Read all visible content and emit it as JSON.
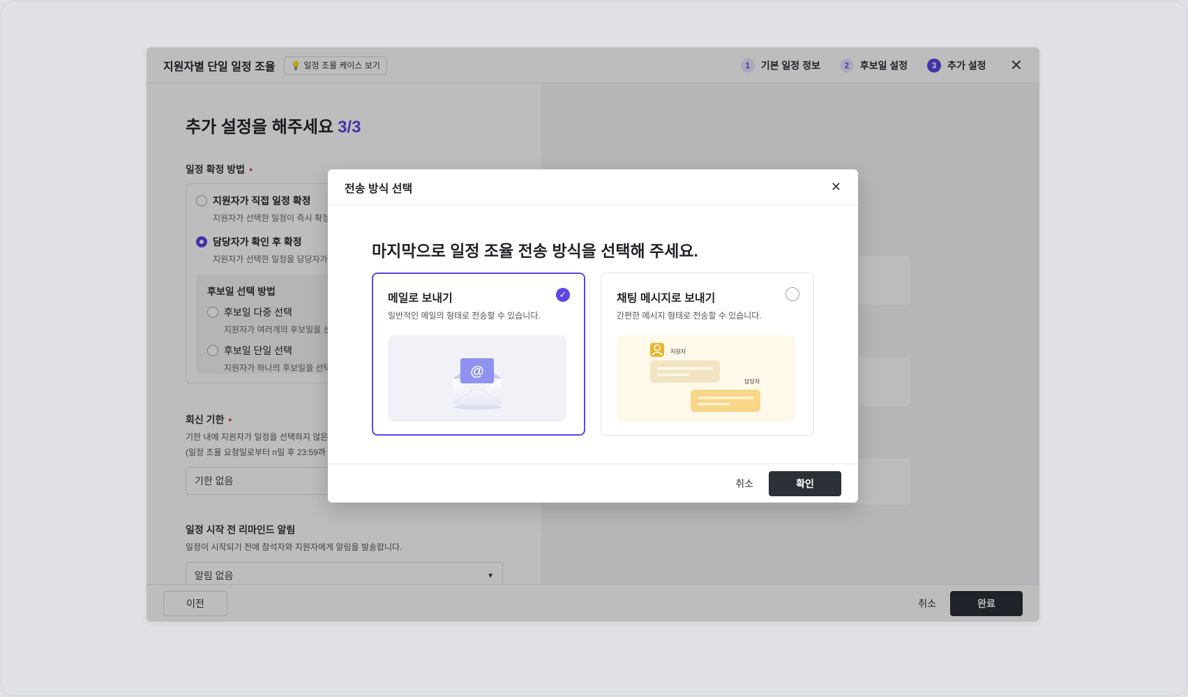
{
  "wizard": {
    "title": "지원자별 단일 일정 조율",
    "case_button": "일정 조율 케이스 보기",
    "steps": [
      {
        "num": "1",
        "label": "기본 일정 정보"
      },
      {
        "num": "2",
        "label": "후보일 설정"
      },
      {
        "num": "3",
        "label": "추가 설정"
      }
    ],
    "heading": "추가 설정을 해주세요",
    "progress": "3/3",
    "confirm_method": {
      "label": "일정 확정 방법",
      "options": [
        {
          "label": "지원자가 직접 일정 확정",
          "desc": "지원자가 선택한 일정이 즉시 확정됩"
        },
        {
          "label": "담당자가 확인 후 확정",
          "desc": "지원자가 선택한 일정을 담당자가 확"
        }
      ],
      "sub": {
        "title": "후보일 선택 방법",
        "options": [
          {
            "label": "후보일 다중 선택",
            "desc": "지원자가 여러개의 후보일을 선택"
          },
          {
            "label": "후보일 단일 선택",
            "desc": "지원자가 하나의 후보일을 선택하"
          }
        ]
      }
    },
    "reply_deadline": {
      "label": "회신 기한",
      "desc1": "기한 내에 지원자가 일정을 선택하지 않은",
      "desc2": "(일정 조율 요청일로부터 n일 후 23:59까",
      "value": "기한 없음"
    },
    "reminder": {
      "label": "일정 시작 전 리마인드 알림",
      "desc": "일정이 시작되기 전에 참석자와 지원자에게 알림을 발송합니다.",
      "value": "알림 없음"
    },
    "footer": {
      "prev": "이전",
      "cancel": "취소",
      "done": "완료"
    }
  },
  "dialog": {
    "title": "전송 방식 선택",
    "heading": "마지막으로 일정 조율 전송 방식을 선택해 주세요.",
    "options": [
      {
        "title": "메일로 보내기",
        "desc": "일반적인 메일의 형태로 전송할 수 있습니다.",
        "selected": true,
        "icon": "envelope-icon"
      },
      {
        "title": "채팅 메시지로 보내기",
        "desc": "간편한 메시지 형태로 전송할 수 있습니다.",
        "selected": false,
        "icon": "chat-icon",
        "illust_labels": {
          "applicant": "지원자",
          "manager": "담당자"
        }
      }
    ],
    "cancel": "취소",
    "confirm": "확인"
  },
  "colors": {
    "accent": "#5b45e6",
    "dark_button": "#2b2f36",
    "required": "#e0443a"
  }
}
